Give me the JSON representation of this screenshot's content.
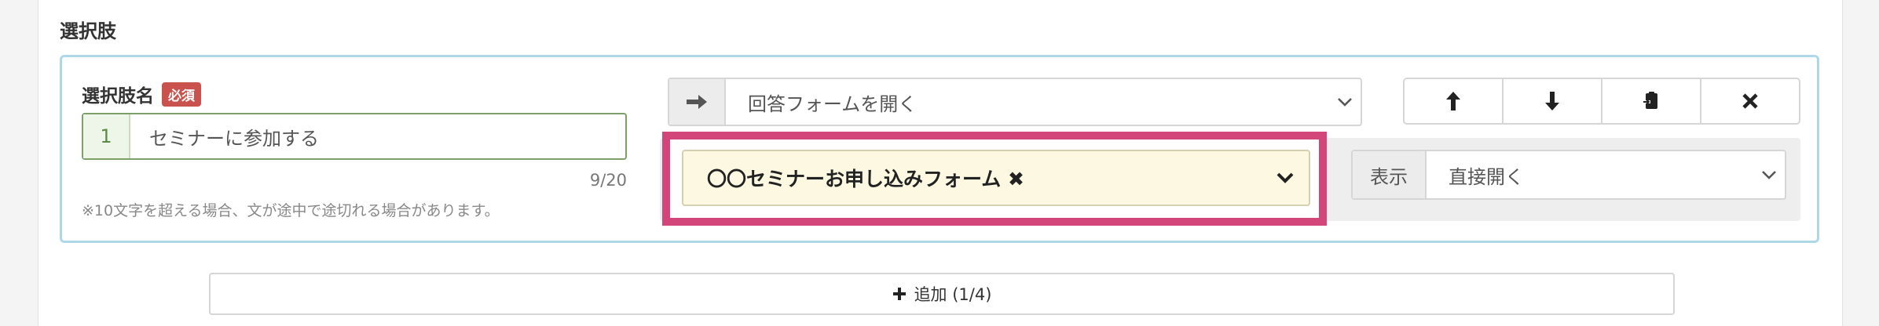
{
  "section": {
    "title": "選択肢"
  },
  "choice": {
    "label": "選択肢名",
    "required_badge": "必須",
    "index": "1",
    "value": "セミナーに参加する",
    "char_count": "9/20",
    "note": "※10文字を超える場合、文が途中で途切れる場合があります。"
  },
  "action": {
    "prefix_icon": "arrow-right-icon",
    "value": "回答フォームを開く"
  },
  "buttons": {
    "up_icon": "arrow-up-icon",
    "down_icon": "arrow-down-icon",
    "copy_icon": "paste-icon",
    "delete_icon": "close-icon"
  },
  "form_select": {
    "value": "〇〇セミナーお申し込みフォーム ✖"
  },
  "display": {
    "label": "表示",
    "value": "直接開く"
  },
  "add": {
    "label": "追加 (1/4)"
  },
  "colors": {
    "highlight": "#d2467a",
    "card_border": "#aed8ea",
    "required": "#c9524f"
  }
}
